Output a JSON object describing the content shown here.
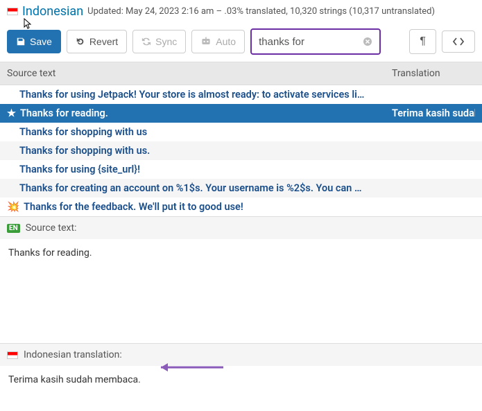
{
  "header": {
    "language": "Indonesian",
    "meta": "Updated: May 24, 2023 2:16 am – .03% translated, 10,320 strings (10,317 untranslated)"
  },
  "toolbar": {
    "save": "Save",
    "revert": "Revert",
    "sync": "Sync",
    "auto": "Auto",
    "search_value": "thanks for"
  },
  "columns": {
    "source": "Source text",
    "translation": "Translation"
  },
  "rows": [
    {
      "text": "Thanks for using Jetpack! Your store is almost ready: to activate services li…",
      "trn": "",
      "selected": false,
      "alt": false,
      "icon": ""
    },
    {
      "text": "Thanks for reading.",
      "trn": "Terima kasih sudah m",
      "selected": true,
      "alt": false,
      "icon": "star"
    },
    {
      "text": "Thanks for shopping with us",
      "trn": "",
      "selected": false,
      "alt": false,
      "icon": ""
    },
    {
      "text": "Thanks for shopping with us.",
      "trn": "",
      "selected": false,
      "alt": true,
      "icon": ""
    },
    {
      "text": "Thanks for using {site_url}!",
      "trn": "",
      "selected": false,
      "alt": false,
      "icon": ""
    },
    {
      "text": "Thanks for creating an account on %1$s. Your username is %2$s. You can …",
      "trn": "",
      "selected": false,
      "alt": true,
      "icon": ""
    },
    {
      "text": "Thanks for the feedback. We'll put it to good use!",
      "trn": "",
      "selected": false,
      "alt": false,
      "icon": "boom"
    }
  ],
  "source_pane": {
    "label": "Source text:",
    "content": "Thanks for reading."
  },
  "translation_pane": {
    "label": "Indonesian translation:",
    "content": "Terima kasih sudah membaca."
  }
}
